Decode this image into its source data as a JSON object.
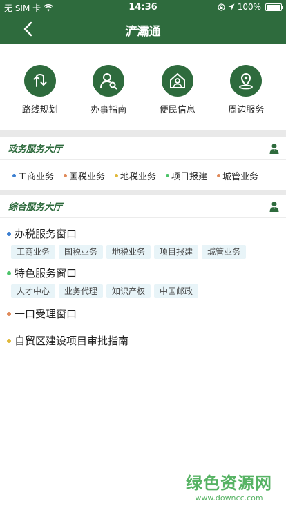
{
  "status": {
    "carrier": "无 SIM 卡",
    "time": "14:36",
    "battery": "100%",
    "battery_level": 1.0,
    "wifi_icon": "wifi-icon",
    "lock_icon": "rotation-lock-icon",
    "location_icon": "location-arrow-icon"
  },
  "nav": {
    "title": "浐灞通",
    "back_icon": "chevron-left-icon"
  },
  "quick": [
    {
      "label": "路线规划",
      "icon": "route-arrows-icon"
    },
    {
      "label": "办事指南",
      "icon": "user-search-icon"
    },
    {
      "label": "便民信息",
      "icon": "home-person-icon"
    },
    {
      "label": "周边服务",
      "icon": "location-pin-icon"
    }
  ],
  "gov": {
    "title": "政务服务大厅",
    "icon": "service-staff-icon",
    "items": [
      {
        "label": "工商业务",
        "color": "#3b7fd1"
      },
      {
        "label": "国税业务",
        "color": "#e08a5a"
      },
      {
        "label": "地税业务",
        "color": "#e0b83a"
      },
      {
        "label": "项目报建",
        "color": "#4cc46a"
      },
      {
        "label": "城管业务",
        "color": "#e08a5a"
      }
    ]
  },
  "general": {
    "title": "综合服务大厅",
    "icon": "service-staff-icon",
    "windows": [
      {
        "label": "办税服务窗口",
        "color": "#3b7fd1",
        "tags": [
          "工商业务",
          "国税业务",
          "地税业务",
          "项目报建",
          "城管业务"
        ]
      },
      {
        "label": "特色服务窗口",
        "color": "#4cc46a",
        "tags": [
          "人才中心",
          "业务代理",
          "知识产权",
          "中国邮政"
        ]
      },
      {
        "label": "一口受理窗口",
        "color": "#e08a5a",
        "tags": []
      },
      {
        "label": "自贸区建设项目审批指南",
        "color": "#e0b83a",
        "tags": []
      }
    ]
  },
  "watermark": {
    "text": "绿色资源网",
    "url": "www.downcc.com"
  }
}
